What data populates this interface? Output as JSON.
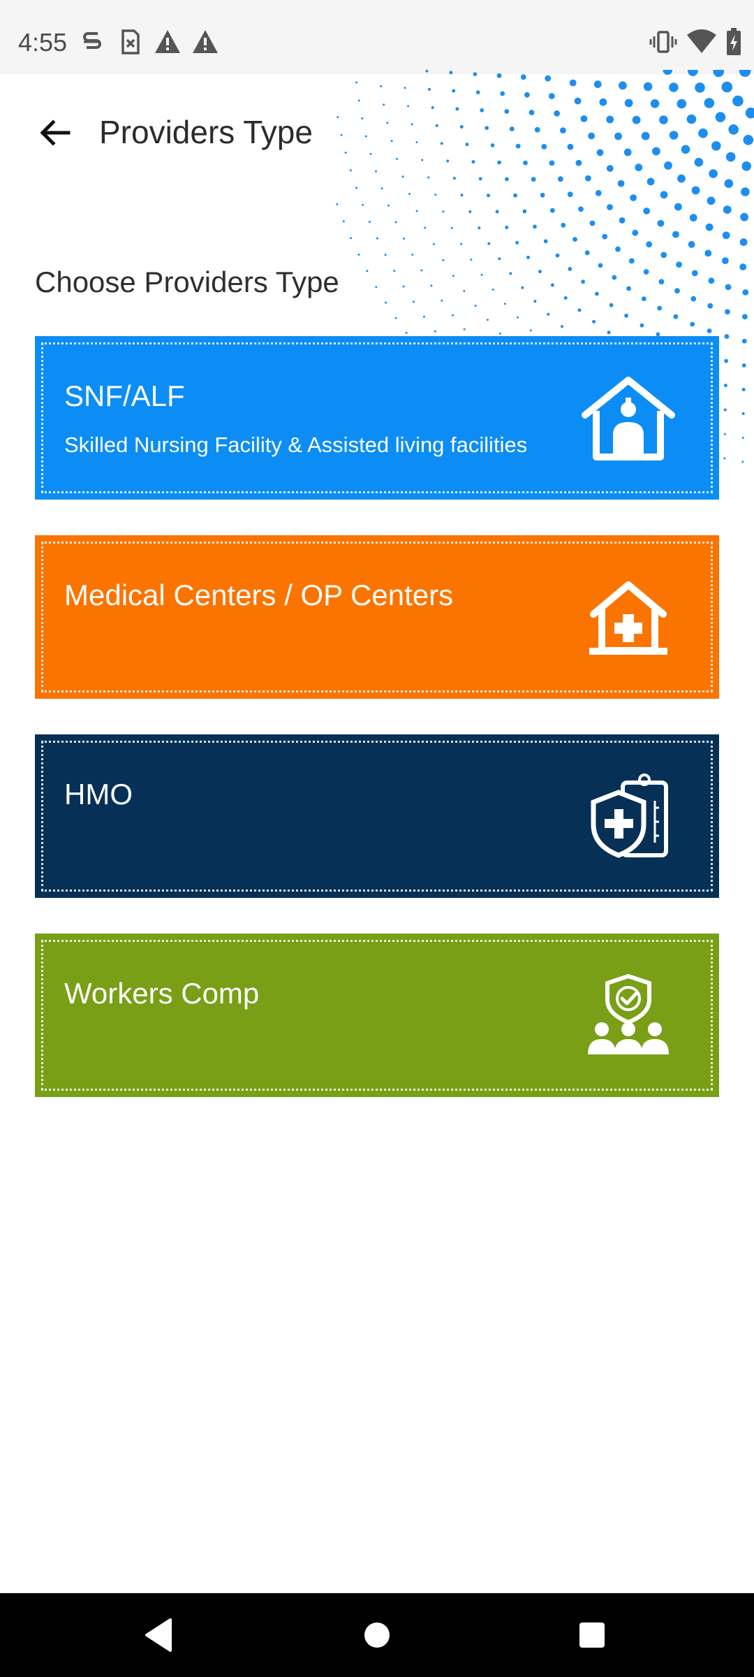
{
  "status_bar": {
    "time": "4:55",
    "left_icons": [
      "s-icon",
      "sim-off-icon",
      "warning-icon",
      "warning-icon"
    ],
    "right_icons": [
      "vibrate-icon",
      "wifi-icon",
      "battery-charging-icon"
    ]
  },
  "header": {
    "back_icon": "arrow-back-icon",
    "title": "Providers Type"
  },
  "section_title": "Choose Providers Type",
  "providers": [
    {
      "title": "SNF/ALF",
      "subtitle": "Skilled Nursing Facility & Assisted living facilities",
      "color": "#0b8df5",
      "icon": "nursing-home-icon"
    },
    {
      "title": "Medical Centers / OP Centers",
      "subtitle": "",
      "color": "#fb7400",
      "icon": "medical-house-icon"
    },
    {
      "title": "HMO",
      "subtitle": "",
      "color": "#063056",
      "icon": "shield-clipboard-icon"
    },
    {
      "title": "Workers Comp",
      "subtitle": "",
      "color": "#789f15",
      "icon": "workers-shield-icon"
    }
  ],
  "nav": {
    "back": "back-triangle-icon",
    "home": "home-circle-icon",
    "recents": "recents-square-icon"
  },
  "colors": {
    "dots": "#1d8ef0",
    "status_bg": "#f5f5f5",
    "nav_bg": "#000000"
  }
}
